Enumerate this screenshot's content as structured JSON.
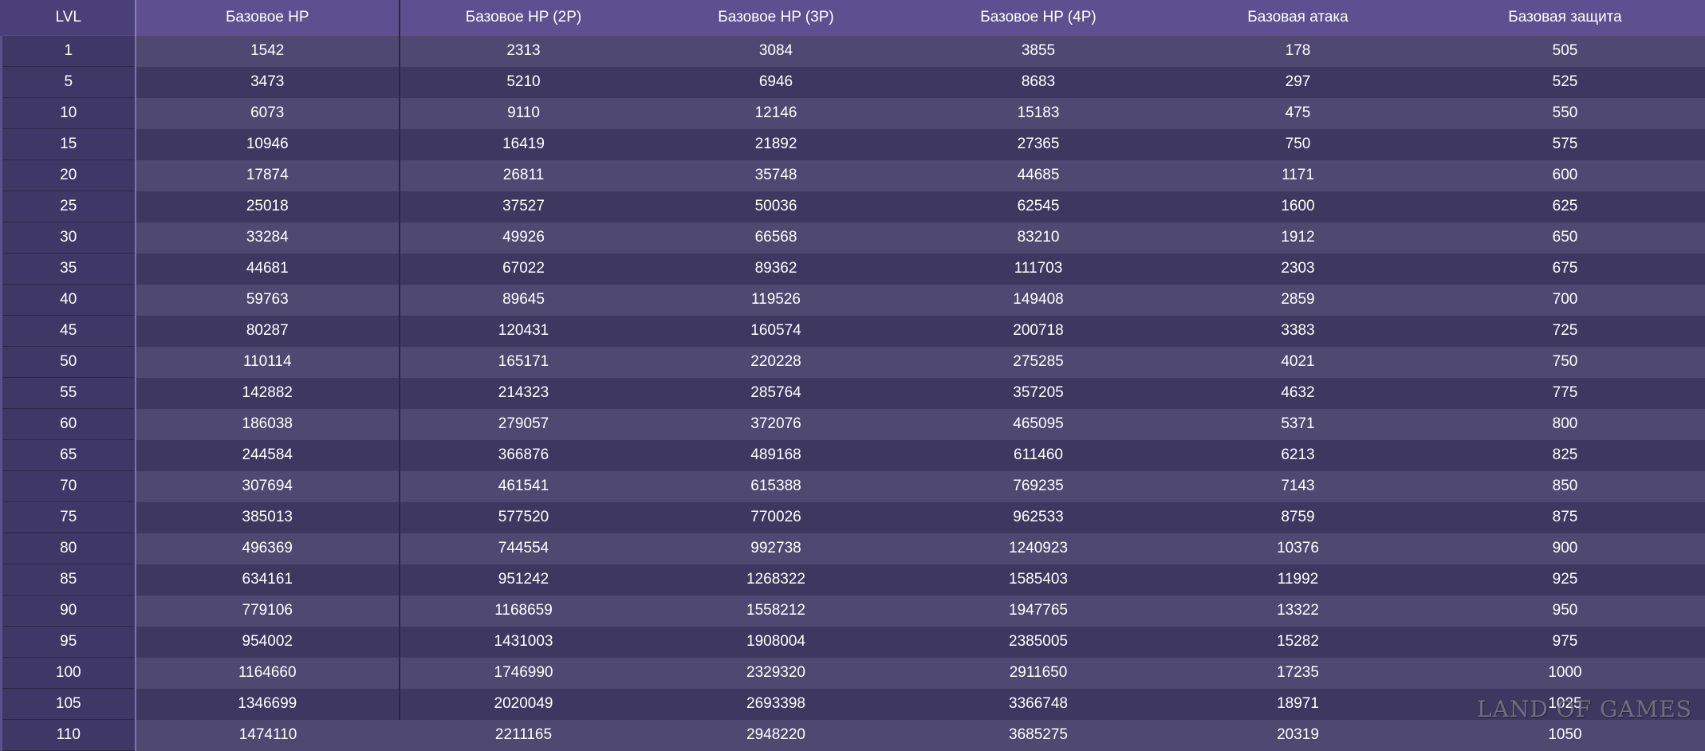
{
  "table": {
    "headers": [
      "LVL",
      "Базовое HP",
      "Базовое HP (2P)",
      "Базовое HP (3P)",
      "Базовое HP (4P)",
      "Базовая атака",
      "Базовая защита"
    ],
    "rows": [
      [
        "1",
        "1542",
        "2313",
        "3084",
        "3855",
        "178",
        "505"
      ],
      [
        "5",
        "3473",
        "5210",
        "6946",
        "8683",
        "297",
        "525"
      ],
      [
        "10",
        "6073",
        "9110",
        "12146",
        "15183",
        "475",
        "550"
      ],
      [
        "15",
        "10946",
        "16419",
        "21892",
        "27365",
        "750",
        "575"
      ],
      [
        "20",
        "17874",
        "26811",
        "35748",
        "44685",
        "1171",
        "600"
      ],
      [
        "25",
        "25018",
        "37527",
        "50036",
        "62545",
        "1600",
        "625"
      ],
      [
        "30",
        "33284",
        "49926",
        "66568",
        "83210",
        "1912",
        "650"
      ],
      [
        "35",
        "44681",
        "67022",
        "89362",
        "111703",
        "2303",
        "675"
      ],
      [
        "40",
        "59763",
        "89645",
        "119526",
        "149408",
        "2859",
        "700"
      ],
      [
        "45",
        "80287",
        "120431",
        "160574",
        "200718",
        "3383",
        "725"
      ],
      [
        "50",
        "110114",
        "165171",
        "220228",
        "275285",
        "4021",
        "750"
      ],
      [
        "55",
        "142882",
        "214323",
        "285764",
        "357205",
        "4632",
        "775"
      ],
      [
        "60",
        "186038",
        "279057",
        "372076",
        "465095",
        "5371",
        "800"
      ],
      [
        "65",
        "244584",
        "366876",
        "489168",
        "611460",
        "6213",
        "825"
      ],
      [
        "70",
        "307694",
        "461541",
        "615388",
        "769235",
        "7143",
        "850"
      ],
      [
        "75",
        "385013",
        "577520",
        "770026",
        "962533",
        "8759",
        "875"
      ],
      [
        "80",
        "496369",
        "744554",
        "992738",
        "1240923",
        "10376",
        "900"
      ],
      [
        "85",
        "634161",
        "951242",
        "1268322",
        "1585403",
        "11992",
        "925"
      ],
      [
        "90",
        "779106",
        "1168659",
        "1558212",
        "1947765",
        "13322",
        "950"
      ],
      [
        "95",
        "954002",
        "1431003",
        "1908004",
        "2385005",
        "15282",
        "975"
      ],
      [
        "100",
        "1164660",
        "1746990",
        "2329320",
        "2911650",
        "17235",
        "1000"
      ],
      [
        "105",
        "1346699",
        "2020049",
        "2693398",
        "3366748",
        "18971",
        "1025"
      ],
      [
        "110",
        "1474110",
        "2211165",
        "2948220",
        "3685275",
        "20319",
        "1050"
      ]
    ]
  },
  "watermark": "LAND OF GAMES",
  "colors": {
    "header_bg": "#5e5090",
    "row_light": "#4f4870",
    "row_dark": "#3e3860",
    "lvl_column_bg": "#3f3866"
  }
}
